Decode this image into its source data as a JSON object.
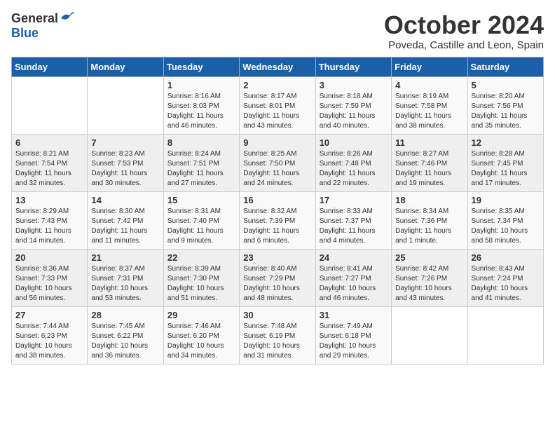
{
  "logo": {
    "general": "General",
    "blue": "Blue"
  },
  "header": {
    "month": "October 2024",
    "location": "Poveda, Castille and Leon, Spain"
  },
  "weekdays": [
    "Sunday",
    "Monday",
    "Tuesday",
    "Wednesday",
    "Thursday",
    "Friday",
    "Saturday"
  ],
  "weeks": [
    [
      {
        "day": "",
        "info": ""
      },
      {
        "day": "",
        "info": ""
      },
      {
        "day": "1",
        "info": "Sunrise: 8:16 AM\nSunset: 8:03 PM\nDaylight: 11 hours and 46 minutes."
      },
      {
        "day": "2",
        "info": "Sunrise: 8:17 AM\nSunset: 8:01 PM\nDaylight: 11 hours and 43 minutes."
      },
      {
        "day": "3",
        "info": "Sunrise: 8:18 AM\nSunset: 7:59 PM\nDaylight: 11 hours and 40 minutes."
      },
      {
        "day": "4",
        "info": "Sunrise: 8:19 AM\nSunset: 7:58 PM\nDaylight: 11 hours and 38 minutes."
      },
      {
        "day": "5",
        "info": "Sunrise: 8:20 AM\nSunset: 7:56 PM\nDaylight: 11 hours and 35 minutes."
      }
    ],
    [
      {
        "day": "6",
        "info": "Sunrise: 8:21 AM\nSunset: 7:54 PM\nDaylight: 11 hours and 32 minutes."
      },
      {
        "day": "7",
        "info": "Sunrise: 8:23 AM\nSunset: 7:53 PM\nDaylight: 11 hours and 30 minutes."
      },
      {
        "day": "8",
        "info": "Sunrise: 8:24 AM\nSunset: 7:51 PM\nDaylight: 11 hours and 27 minutes."
      },
      {
        "day": "9",
        "info": "Sunrise: 8:25 AM\nSunset: 7:50 PM\nDaylight: 11 hours and 24 minutes."
      },
      {
        "day": "10",
        "info": "Sunrise: 8:26 AM\nSunset: 7:48 PM\nDaylight: 11 hours and 22 minutes."
      },
      {
        "day": "11",
        "info": "Sunrise: 8:27 AM\nSunset: 7:46 PM\nDaylight: 11 hours and 19 minutes."
      },
      {
        "day": "12",
        "info": "Sunrise: 8:28 AM\nSunset: 7:45 PM\nDaylight: 11 hours and 17 minutes."
      }
    ],
    [
      {
        "day": "13",
        "info": "Sunrise: 8:29 AM\nSunset: 7:43 PM\nDaylight: 11 hours and 14 minutes."
      },
      {
        "day": "14",
        "info": "Sunrise: 8:30 AM\nSunset: 7:42 PM\nDaylight: 11 hours and 11 minutes."
      },
      {
        "day": "15",
        "info": "Sunrise: 8:31 AM\nSunset: 7:40 PM\nDaylight: 11 hours and 9 minutes."
      },
      {
        "day": "16",
        "info": "Sunrise: 8:32 AM\nSunset: 7:39 PM\nDaylight: 11 hours and 6 minutes."
      },
      {
        "day": "17",
        "info": "Sunrise: 8:33 AM\nSunset: 7:37 PM\nDaylight: 11 hours and 4 minutes."
      },
      {
        "day": "18",
        "info": "Sunrise: 8:34 AM\nSunset: 7:36 PM\nDaylight: 11 hours and 1 minute."
      },
      {
        "day": "19",
        "info": "Sunrise: 8:35 AM\nSunset: 7:34 PM\nDaylight: 10 hours and 58 minutes."
      }
    ],
    [
      {
        "day": "20",
        "info": "Sunrise: 8:36 AM\nSunset: 7:33 PM\nDaylight: 10 hours and 56 minutes."
      },
      {
        "day": "21",
        "info": "Sunrise: 8:37 AM\nSunset: 7:31 PM\nDaylight: 10 hours and 53 minutes."
      },
      {
        "day": "22",
        "info": "Sunrise: 8:39 AM\nSunset: 7:30 PM\nDaylight: 10 hours and 51 minutes."
      },
      {
        "day": "23",
        "info": "Sunrise: 8:40 AM\nSunset: 7:29 PM\nDaylight: 10 hours and 48 minutes."
      },
      {
        "day": "24",
        "info": "Sunrise: 8:41 AM\nSunset: 7:27 PM\nDaylight: 10 hours and 46 minutes."
      },
      {
        "day": "25",
        "info": "Sunrise: 8:42 AM\nSunset: 7:26 PM\nDaylight: 10 hours and 43 minutes."
      },
      {
        "day": "26",
        "info": "Sunrise: 8:43 AM\nSunset: 7:24 PM\nDaylight: 10 hours and 41 minutes."
      }
    ],
    [
      {
        "day": "27",
        "info": "Sunrise: 7:44 AM\nSunset: 6:23 PM\nDaylight: 10 hours and 38 minutes."
      },
      {
        "day": "28",
        "info": "Sunrise: 7:45 AM\nSunset: 6:22 PM\nDaylight: 10 hours and 36 minutes."
      },
      {
        "day": "29",
        "info": "Sunrise: 7:46 AM\nSunset: 6:20 PM\nDaylight: 10 hours and 34 minutes."
      },
      {
        "day": "30",
        "info": "Sunrise: 7:48 AM\nSunset: 6:19 PM\nDaylight: 10 hours and 31 minutes."
      },
      {
        "day": "31",
        "info": "Sunrise: 7:49 AM\nSunset: 6:18 PM\nDaylight: 10 hours and 29 minutes."
      },
      {
        "day": "",
        "info": ""
      },
      {
        "day": "",
        "info": ""
      }
    ]
  ]
}
